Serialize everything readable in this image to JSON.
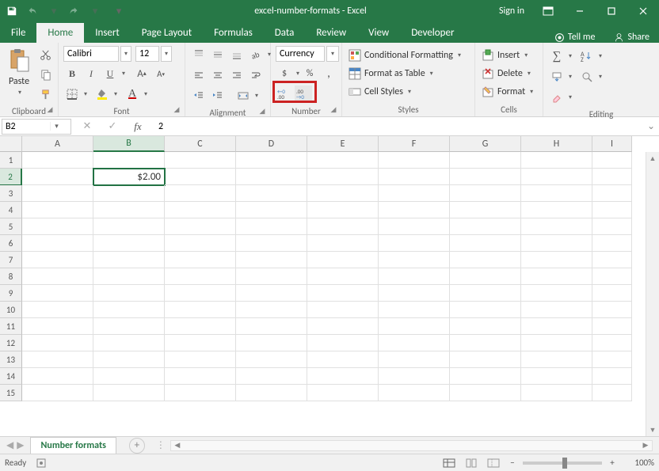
{
  "title": "excel-number-formats - Excel",
  "signin": "Sign in",
  "tabs": {
    "file": "File",
    "home": "Home",
    "insert": "Insert",
    "pagelayout": "Page Layout",
    "formulas": "Formulas",
    "data": "Data",
    "review": "Review",
    "view": "View",
    "developer": "Developer",
    "tellme": "Tell me",
    "share": "Share"
  },
  "ribbon": {
    "clipboard": {
      "label": "Clipboard",
      "paste": "Paste"
    },
    "font": {
      "label": "Font",
      "name": "Calibri",
      "size": "12"
    },
    "alignment": {
      "label": "Alignment"
    },
    "number": {
      "label": "Number",
      "format": "Currency",
      "currency": "$",
      "percent": "%",
      "comma": ","
    },
    "styles": {
      "label": "Styles",
      "cond": "Conditional Formatting",
      "table": "Format as Table",
      "cell": "Cell Styles"
    },
    "cells": {
      "label": "Cells",
      "insert": "Insert",
      "delete": "Delete",
      "format": "Format"
    },
    "editing": {
      "label": "Editing"
    }
  },
  "namebox": "B2",
  "formula": "2",
  "columns": [
    "A",
    "B",
    "C",
    "D",
    "E",
    "F",
    "G",
    "H",
    "I"
  ],
  "rows": [
    "1",
    "2",
    "3",
    "4",
    "5",
    "6",
    "7",
    "8",
    "9",
    "10",
    "11",
    "12",
    "13",
    "14",
    "15"
  ],
  "active_cell_value": "$2.00",
  "sheet": {
    "name": "Number formats"
  },
  "status": {
    "ready": "Ready",
    "zoom": "100%"
  }
}
